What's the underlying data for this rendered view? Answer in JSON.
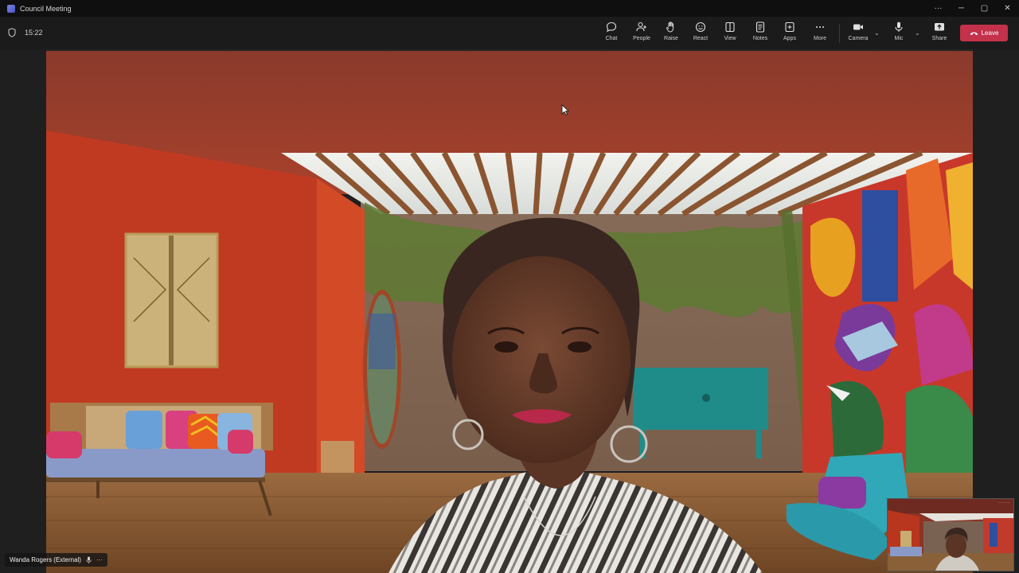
{
  "window": {
    "title": "Council Meeting",
    "controls": [
      "···",
      "─",
      "▢",
      "✕"
    ]
  },
  "toolbar": {
    "timer": "15:22",
    "items": [
      {
        "label": "Chat",
        "icon": "chat-icon"
      },
      {
        "label": "People",
        "icon": "people-icon"
      },
      {
        "label": "Raise",
        "icon": "raise-hand-icon"
      },
      {
        "label": "React",
        "icon": "react-icon"
      },
      {
        "label": "View",
        "icon": "view-icon"
      },
      {
        "label": "Notes",
        "icon": "notes-icon"
      },
      {
        "label": "Apps",
        "icon": "apps-icon"
      },
      {
        "label": "More",
        "icon": "more-icon"
      },
      {
        "label": "Camera",
        "icon": "camera-icon"
      },
      {
        "label": "Mic",
        "icon": "mic-icon"
      },
      {
        "label": "Share",
        "icon": "share-icon"
      }
    ],
    "leave_label": "Leave",
    "leave_color": "#c4314b"
  },
  "participant": {
    "name": "Wanda Rogers (External)",
    "name_icons": [
      "mic-icon",
      "more-icon"
    ]
  },
  "selfview": {
    "menu": "·····"
  }
}
